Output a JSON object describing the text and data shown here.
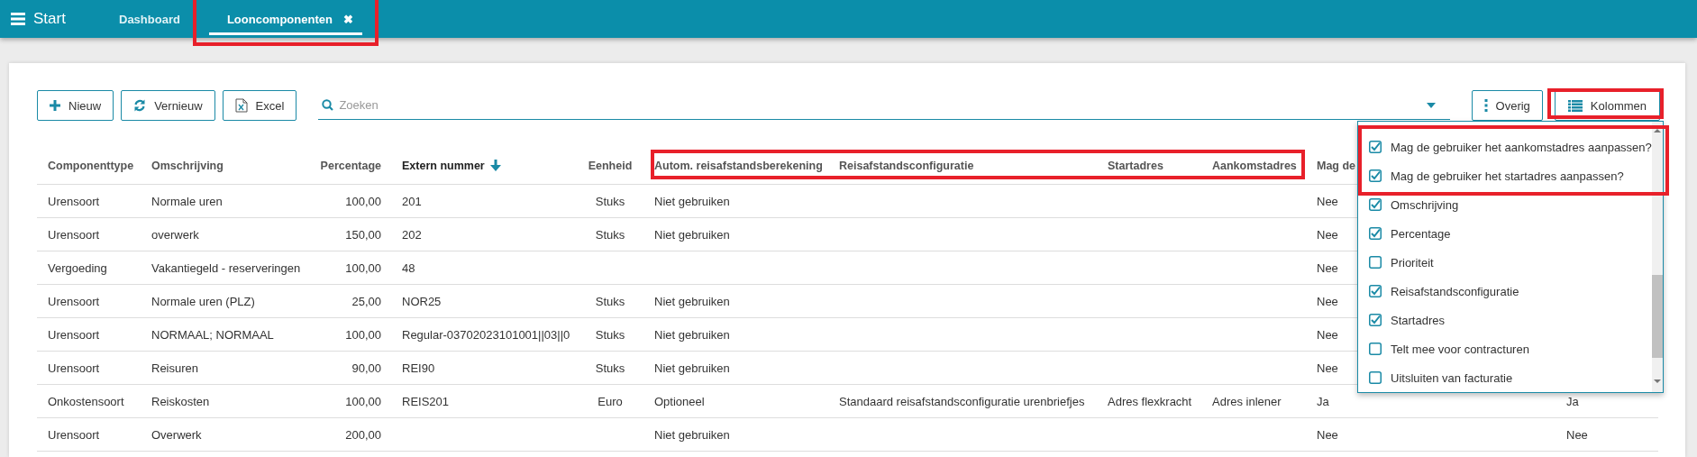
{
  "top_bar": {
    "menu_label": "Start",
    "tabs": [
      {
        "label": "Dashboard",
        "selected": false,
        "closable": false,
        "highlighted": false
      },
      {
        "label": "Looncomponenten",
        "selected": true,
        "closable": true,
        "close_glyph": "✖",
        "highlighted": true
      }
    ]
  },
  "toolbar": {
    "buttons": [
      {
        "label": "Nieuw"
      },
      {
        "label": "Vernieuw"
      },
      {
        "label": "Excel"
      }
    ],
    "search": {
      "placeholder": "Zoeken"
    },
    "right_buttons": [
      {
        "label": "Overig",
        "highlighted": false
      },
      {
        "label": "Kolommen",
        "highlighted": true
      }
    ]
  },
  "table": {
    "columns": [
      {
        "label": "Componenttype",
        "sorted": false,
        "highlighted": false
      },
      {
        "label": "Omschrijving",
        "sorted": false,
        "highlighted": false
      },
      {
        "label": "Percentage",
        "sorted": false,
        "highlighted": false
      },
      {
        "label": "Extern nummer",
        "sorted": true,
        "highlighted": false
      },
      {
        "label": "Eenheid",
        "sorted": false,
        "highlighted": false
      },
      {
        "label": "Autom. reisafstandsberekening",
        "sorted": false,
        "highlighted": true
      },
      {
        "label": "Reisafstandsconfiguratie",
        "sorted": false,
        "highlighted": true
      },
      {
        "label": "Startadres",
        "sorted": false,
        "highlighted": true
      },
      {
        "label": "Aankomstadres",
        "sorted": false,
        "highlighted": true
      },
      {
        "label": "Mag de",
        "sorted": false,
        "highlighted": false
      }
    ],
    "rows": [
      [
        "Urensoort",
        "Normale uren",
        "100,00",
        "201",
        "Stuks",
        "Niet gebruiken",
        null,
        null,
        null,
        "Nee",
        null
      ],
      [
        "Urensoort",
        "overwerk",
        "150,00",
        "202",
        "Stuks",
        "Niet gebruiken",
        null,
        null,
        null,
        "Nee",
        null
      ],
      [
        "Vergoeding",
        "Vakantiegeld - reserveringen",
        "100,00",
        "48",
        null,
        null,
        null,
        null,
        null,
        "Nee",
        null
      ],
      [
        "Urensoort",
        "Normale uren (PLZ)",
        "25,00",
        "NOR25",
        "Stuks",
        "Niet gebruiken",
        null,
        null,
        null,
        "Nee",
        null
      ],
      [
        "Urensoort",
        "NORMAAL; NORMAAL",
        "100,00",
        "Regular-03702023101001||03||0",
        "Stuks",
        "Niet gebruiken",
        null,
        null,
        null,
        "Nee",
        null
      ],
      [
        "Urensoort",
        "Reisuren",
        "90,00",
        "REI90",
        "Stuks",
        "Niet gebruiken",
        null,
        null,
        null,
        "Nee",
        null
      ],
      [
        "Onkostensoort",
        "Reiskosten",
        "100,00",
        "REIS201",
        "Euro",
        "Optioneel",
        "Standaard reisafstandsconfiguratie urenbriefjes",
        "Adres flexkracht",
        "Adres inlener",
        "Ja",
        "Ja"
      ],
      [
        "Urensoort",
        "Overwerk",
        "200,00",
        null,
        null,
        "Niet gebruiken",
        null,
        null,
        null,
        "Nee",
        "Nee"
      ]
    ]
  },
  "column_menu": {
    "items": [
      {
        "label": "Mag de gebruiker het aankomstadres aanpassen?",
        "checked": true,
        "highlighted": true
      },
      {
        "label": "Mag de gebruiker het startadres aanpassen?",
        "checked": true,
        "highlighted": true
      },
      {
        "label": "Omschrijving",
        "checked": true,
        "highlighted": false
      },
      {
        "label": "Percentage",
        "checked": true,
        "highlighted": false
      },
      {
        "label": "Prioriteit",
        "checked": false,
        "highlighted": false
      },
      {
        "label": "Reisafstandsconfiguratie",
        "checked": true,
        "highlighted": false
      },
      {
        "label": "Startadres",
        "checked": true,
        "highlighted": false
      },
      {
        "label": "Telt mee voor contracturen",
        "checked": false,
        "highlighted": false
      },
      {
        "label": "Uitsluiten van facturatie",
        "checked": false,
        "highlighted": false
      }
    ]
  }
}
